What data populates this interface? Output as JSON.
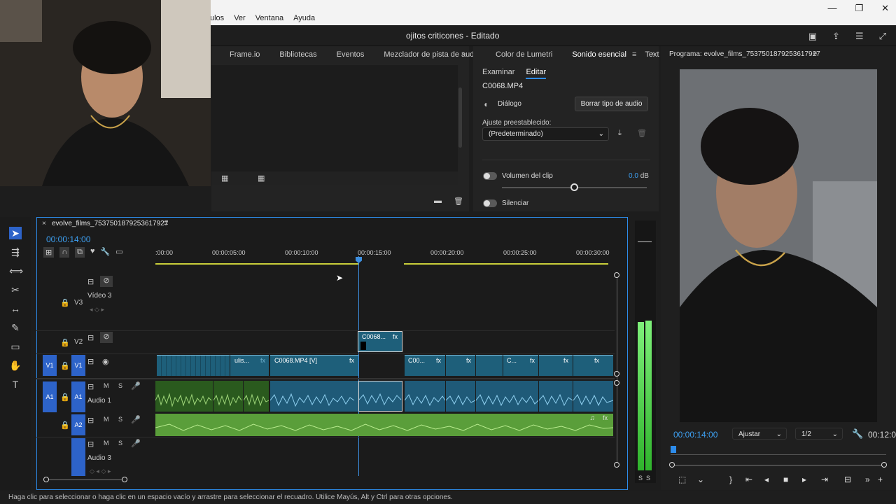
{
  "menu": [
    "ulos",
    "Ver",
    "Ventana",
    "Ayuda"
  ],
  "window_controls": [
    "—",
    "❐",
    "✕"
  ],
  "app": {
    "title": "ojitos criticones - Editado"
  },
  "project_panel": {
    "tabs": [
      "Frame.io",
      "Bibliotecas",
      "Eventos",
      "Mezclador de pista de audic"
    ]
  },
  "essential_panel": {
    "tabs": [
      "Color de Lumetri",
      "Sonido esencial",
      "Text"
    ],
    "subtabs": [
      "Examinar",
      "Editar"
    ],
    "clip_name": "C0068.MP4",
    "dialog_label": "Diálogo",
    "clear_button": "Borrar tipo de audio",
    "preset_label": "Ajuste preestablecido:",
    "preset_value": "(Predeterminado)",
    "clip_volume_label": "Volumen del clip",
    "clip_volume_value": "0.0",
    "clip_volume_unit": "dB",
    "clip_volume_level": 0.5,
    "mute_label": "Silenciar"
  },
  "program_monitor": {
    "title": "Programa: evolve_films_7537501879253617927",
    "timecode": "00:00:14:00",
    "fit": "Ajustar",
    "resolution": "1/2",
    "end_timecode": "00:12:0"
  },
  "timeline": {
    "close": "×",
    "sequence_name": "evolve_films_7537501879253617927",
    "timecode": "00:00:14:00",
    "ruler": [
      ":00:00",
      "00:00:05:00",
      "00:00:10:00",
      "00:00:15:00",
      "00:00:20:00",
      "00:00:25:00",
      "00:00:30:00"
    ],
    "tracks": {
      "v3": {
        "id": "V3",
        "name": "Vídeo 3"
      },
      "v2": {
        "id": "V2"
      },
      "v1": {
        "src": "V1",
        "id": "V1"
      },
      "a1": {
        "src": "A1",
        "id": "A1",
        "name": "Audio 1"
      },
      "a2": {
        "id": "A2"
      },
      "a3": {
        "name": "Audio 3"
      }
    },
    "clips": {
      "v2_clip": "C0068...",
      "v1_a": "ulis...",
      "v1_b": "C0068.MP4 [V]",
      "v1_c": "C00...",
      "v1_d": "C..."
    },
    "fx": "fx",
    "mute": "M",
    "solo": "S"
  },
  "meter_labels": [
    "S",
    "S"
  ],
  "status": "Haga clic para seleccionar o haga clic en un espacio vacío y arrastre para seleccionar el recuadro. Utilice Mayús, Alt y Ctrl para otras opciones."
}
